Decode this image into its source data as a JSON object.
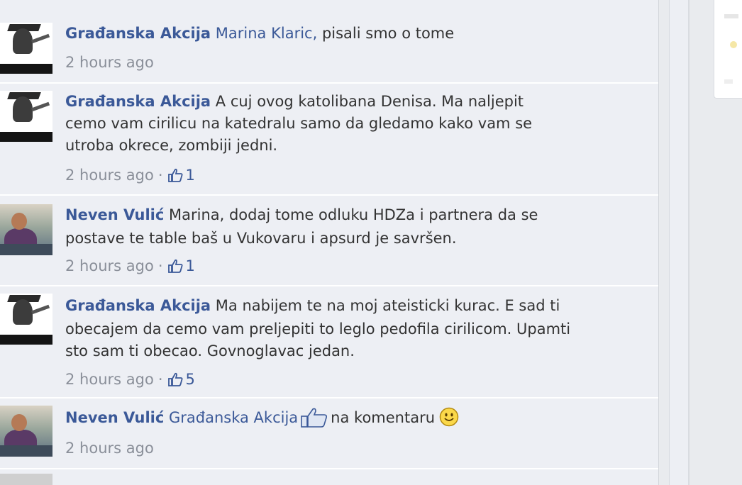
{
  "comments": [
    {
      "author": "Građanska Akcija",
      "mention": "Marina Klaric,",
      "lines": [
        " pisali smo o tome"
      ],
      "time": "2 hours ago",
      "likes": ""
    },
    {
      "author": "Građanska Akcija",
      "lines": [
        " A cuj ovog katolibana Denisa. Ma naljepit",
        "cemo vam cirilicu na katedralu samo da gledamo kako vam se",
        "utroba okrece, zombiji jedni."
      ],
      "time": "2 hours ago",
      "likes": "1"
    },
    {
      "author": "Neven Vulić",
      "lines": [
        " Marina, dodaj tome odluku HDZa i partnera da se",
        "postave te table baš u Vukovaru i apsurd je savršen."
      ],
      "time": "2 hours ago",
      "likes": "1"
    },
    {
      "author": "Građanska Akcija",
      "lines": [
        " Ma nabijem te na moj ateisticki kurac. E sad ti",
        "obecajem da cemo vam preljepiti to leglo pedofila cirilicom. Upamti",
        "sto sam ti obecao. Govnoglavac jedan."
      ],
      "time": "2 hours ago",
      "likes": "5"
    },
    {
      "author": "Neven Vulić",
      "mention": "Građanska Akcija",
      "lines": [
        "na komentaru"
      ],
      "time": "2 hours ago",
      "likes": ""
    }
  ],
  "colors": {
    "link": "#3b5998",
    "meta": "#8a8f99",
    "background": "#edeff4"
  },
  "icons": [
    "like-thumb-icon",
    "smiley-icon"
  ]
}
